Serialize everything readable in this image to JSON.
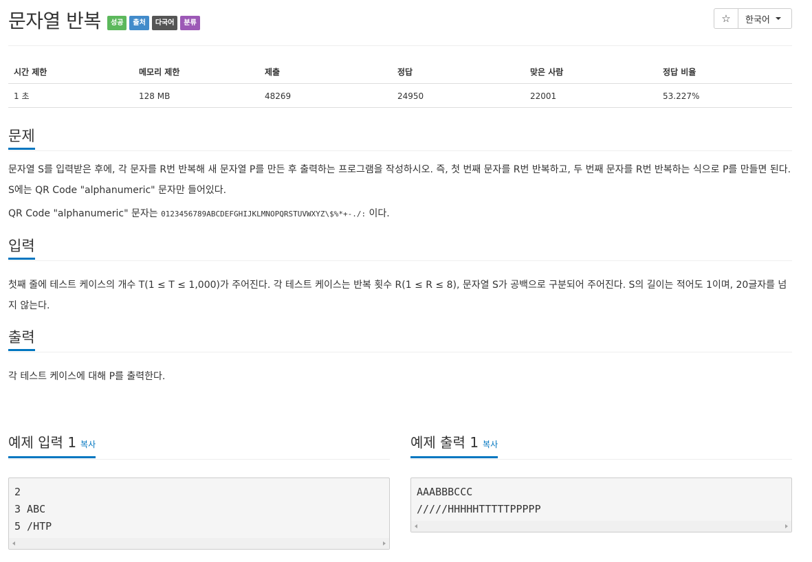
{
  "header": {
    "title": "문자열 반복",
    "badges": [
      "성공",
      "출처",
      "다국어",
      "분류"
    ],
    "star": "☆",
    "language": "한국어"
  },
  "info_table": {
    "headers": [
      "시간 제한",
      "메모리 제한",
      "제출",
      "정답",
      "맞은 사람",
      "정답 비율"
    ],
    "values": [
      "1 초",
      "128 MB",
      "48269",
      "24950",
      "22001",
      "53.227%"
    ]
  },
  "problem": {
    "heading": "문제",
    "para1": "문자열 S를 입력받은 후에, 각 문자를 R번 반복해 새 문자열 P를 만든 후 출력하는 프로그램을 작성하시오. 즉, 첫 번째 문자를 R번 반복하고, 두 번째 문자를 R번 반복하는 식으로 P를 만들면 된다. S에는 QR Code \"alphanumeric\" 문자만 들어있다.",
    "para2_prefix": "QR Code \"alphanumeric\" 문자는 ",
    "para2_code": "0123456789ABCDEFGHIJKLMNOPQRSTUVWXYZ\\$%*+-./:",
    "para2_suffix": " 이다."
  },
  "input": {
    "heading": "입력",
    "text": "첫째 줄에 테스트 케이스의 개수 T(1 ≤ T ≤ 1,000)가 주어진다. 각 테스트 케이스는 반복 횟수 R(1 ≤ R ≤ 8), 문자열 S가 공백으로 구분되어 주어진다. S의 길이는 적어도 1이며, 20글자를 넘지 않는다."
  },
  "output": {
    "heading": "출력",
    "text": "각 테스트 케이스에 대해 P를 출력한다."
  },
  "example_input": {
    "label": "예제 입력 1",
    "copy": "복사",
    "lines": [
      "2",
      "3 ABC",
      "5 /HTP"
    ]
  },
  "example_output": {
    "label": "예제 출력 1",
    "copy": "복사",
    "lines": [
      "AAABBBCCC",
      "/////HHHHHTTTTTPPPPP"
    ]
  }
}
